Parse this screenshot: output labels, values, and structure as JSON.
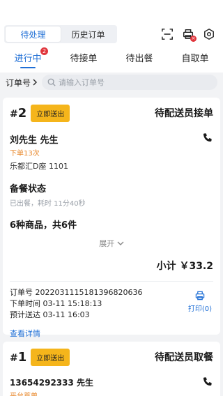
{
  "segment": {
    "items": [
      "待处理",
      "历史订单"
    ],
    "active": 0
  },
  "icons": {
    "scan": "scan-icon",
    "printer": "printer-icon",
    "settings": "settings-icon"
  },
  "tabs": [
    {
      "label": "进行中",
      "badge": "2",
      "active": true
    },
    {
      "label": "待接单"
    },
    {
      "label": "待出餐"
    },
    {
      "label": "自取单"
    }
  ],
  "search": {
    "type_label": "订单号",
    "placeholder": "请输入订单号"
  },
  "orders": [
    {
      "number": "2",
      "deliver_button": "立即送出",
      "status": "待配送员接单",
      "customer_name": "刘先生 先生",
      "order_count": "下单13次",
      "address": "乐都汇D座 1101",
      "prep_title": "备餐状态",
      "prep_status": "已出餐，耗时 11分40秒",
      "items_title": "6种商品，共6件",
      "expand_label": "展开",
      "subtotal": "小计 ￥33.2",
      "order_id": "订单号 20220311151813968206​36",
      "order_time": "下单时间 03-11 15:18:13",
      "eta": "预计送达 03-11 16:03",
      "print_label": "打印(0)",
      "detail_link": "查看详情"
    },
    {
      "number": "1",
      "deliver_button": "立即送出",
      "status": "待配送员取餐",
      "customer_name": "13654292333 先生",
      "order_count": "平台首单"
    }
  ],
  "colors": {
    "accent": "#1f6fd6",
    "button": "#f5b51b",
    "badge": "#e0353c",
    "orange": "#e8872a"
  }
}
